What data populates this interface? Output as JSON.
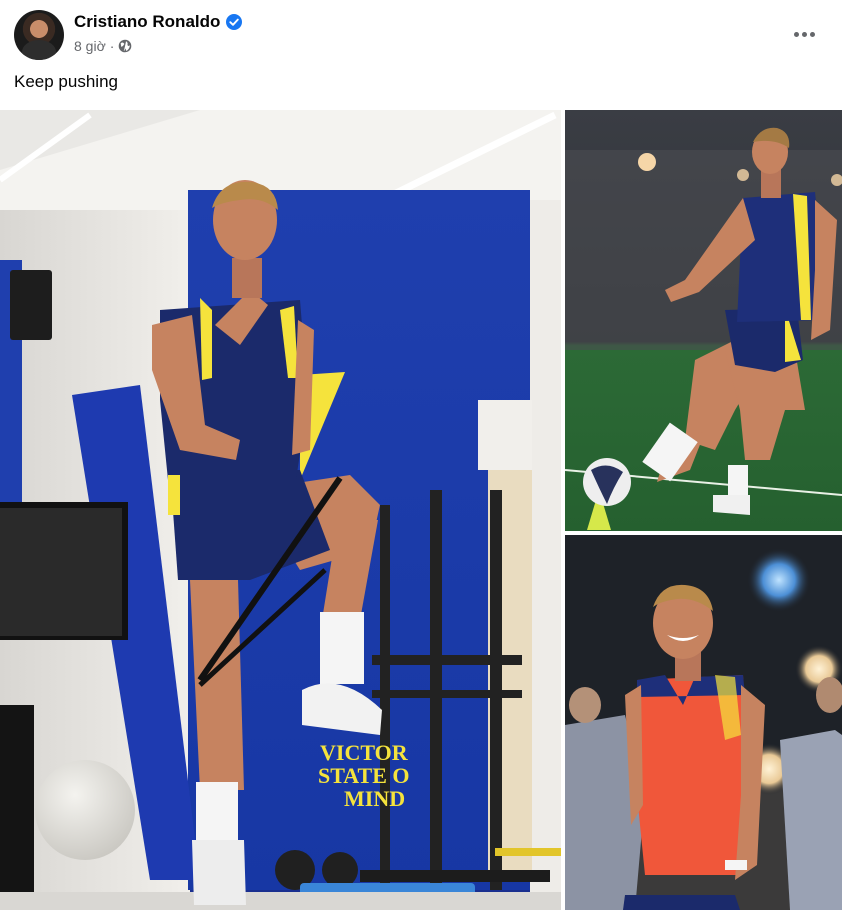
{
  "post": {
    "author": "Cristiano Ronaldo",
    "timestamp": "8 giờ",
    "separator": "·",
    "privacy_icon": "globe-icon",
    "verified_icon": "verified-badge-icon",
    "more_icon": "more-options-icon",
    "caption": "Keep pushing"
  },
  "photos": {
    "main": {
      "wall_text": [
        "VICTOR",
        "STATE O",
        "MIND"
      ]
    }
  },
  "colors": {
    "verified": "#1877f2",
    "secondary_text": "#65676b",
    "kit_navy": "#1b2a6b",
    "kit_yellow": "#f5e33c",
    "bib_orange": "#f0573a"
  }
}
